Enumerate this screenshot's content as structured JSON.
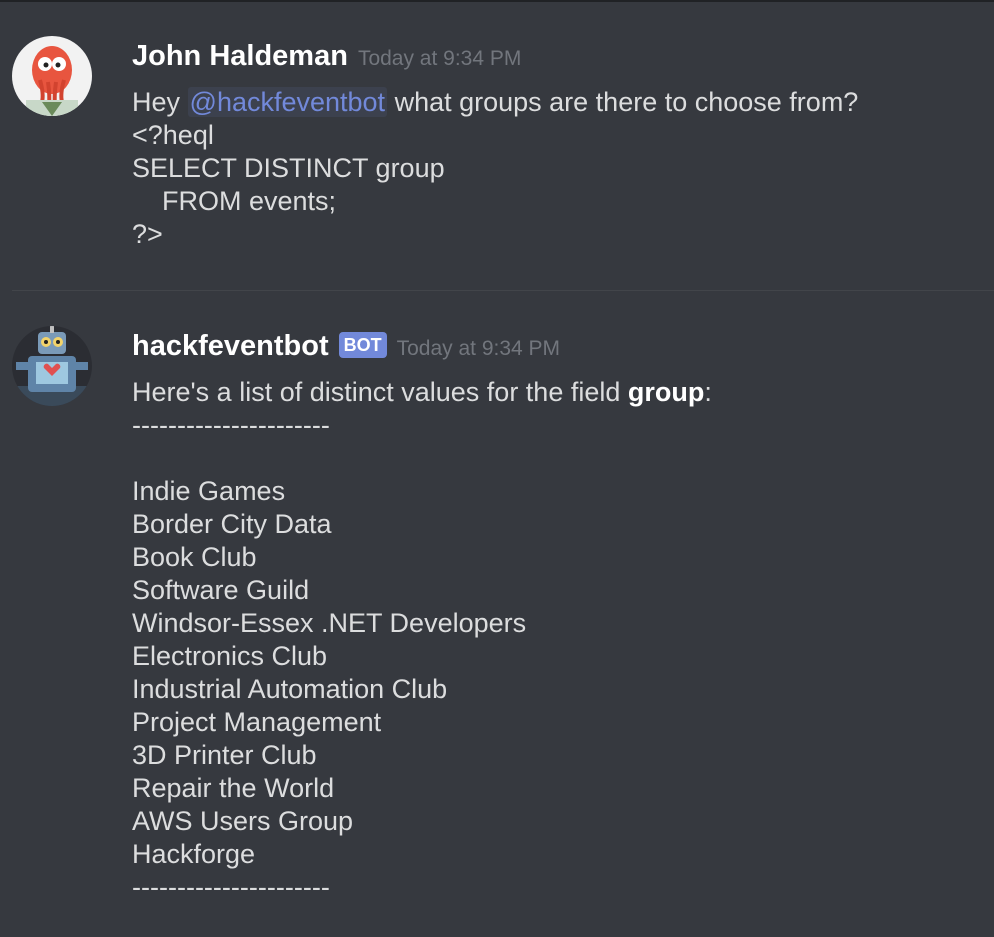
{
  "messages": [
    {
      "author": "John Haldeman",
      "timestamp": "Today at 9:34 PM",
      "text_prefix": "Hey ",
      "mention": "@hackfeventbot",
      "text_suffix": " what groups are there to choose from?",
      "code_lines": [
        "<?heql",
        "SELECT DISTINCT group",
        "    FROM events;",
        "?>"
      ]
    },
    {
      "author": "hackfeventbot",
      "bot_tag": "BOT",
      "timestamp": "Today at 9:34 PM",
      "intro_prefix": "Here's a list of distinct values for the field ",
      "intro_bold": "group",
      "intro_suffix": ":",
      "separator": "----------------------",
      "groups": [
        "Indie Games",
        "Border City Data",
        "Book Club",
        "Software Guild",
        "Windsor-Essex .NET Developers",
        "Electronics Club",
        "Industrial Automation Club",
        "Project Management",
        "3D Printer Club",
        "Repair the World",
        "AWS Users Group",
        "Hackforge"
      ]
    }
  ]
}
